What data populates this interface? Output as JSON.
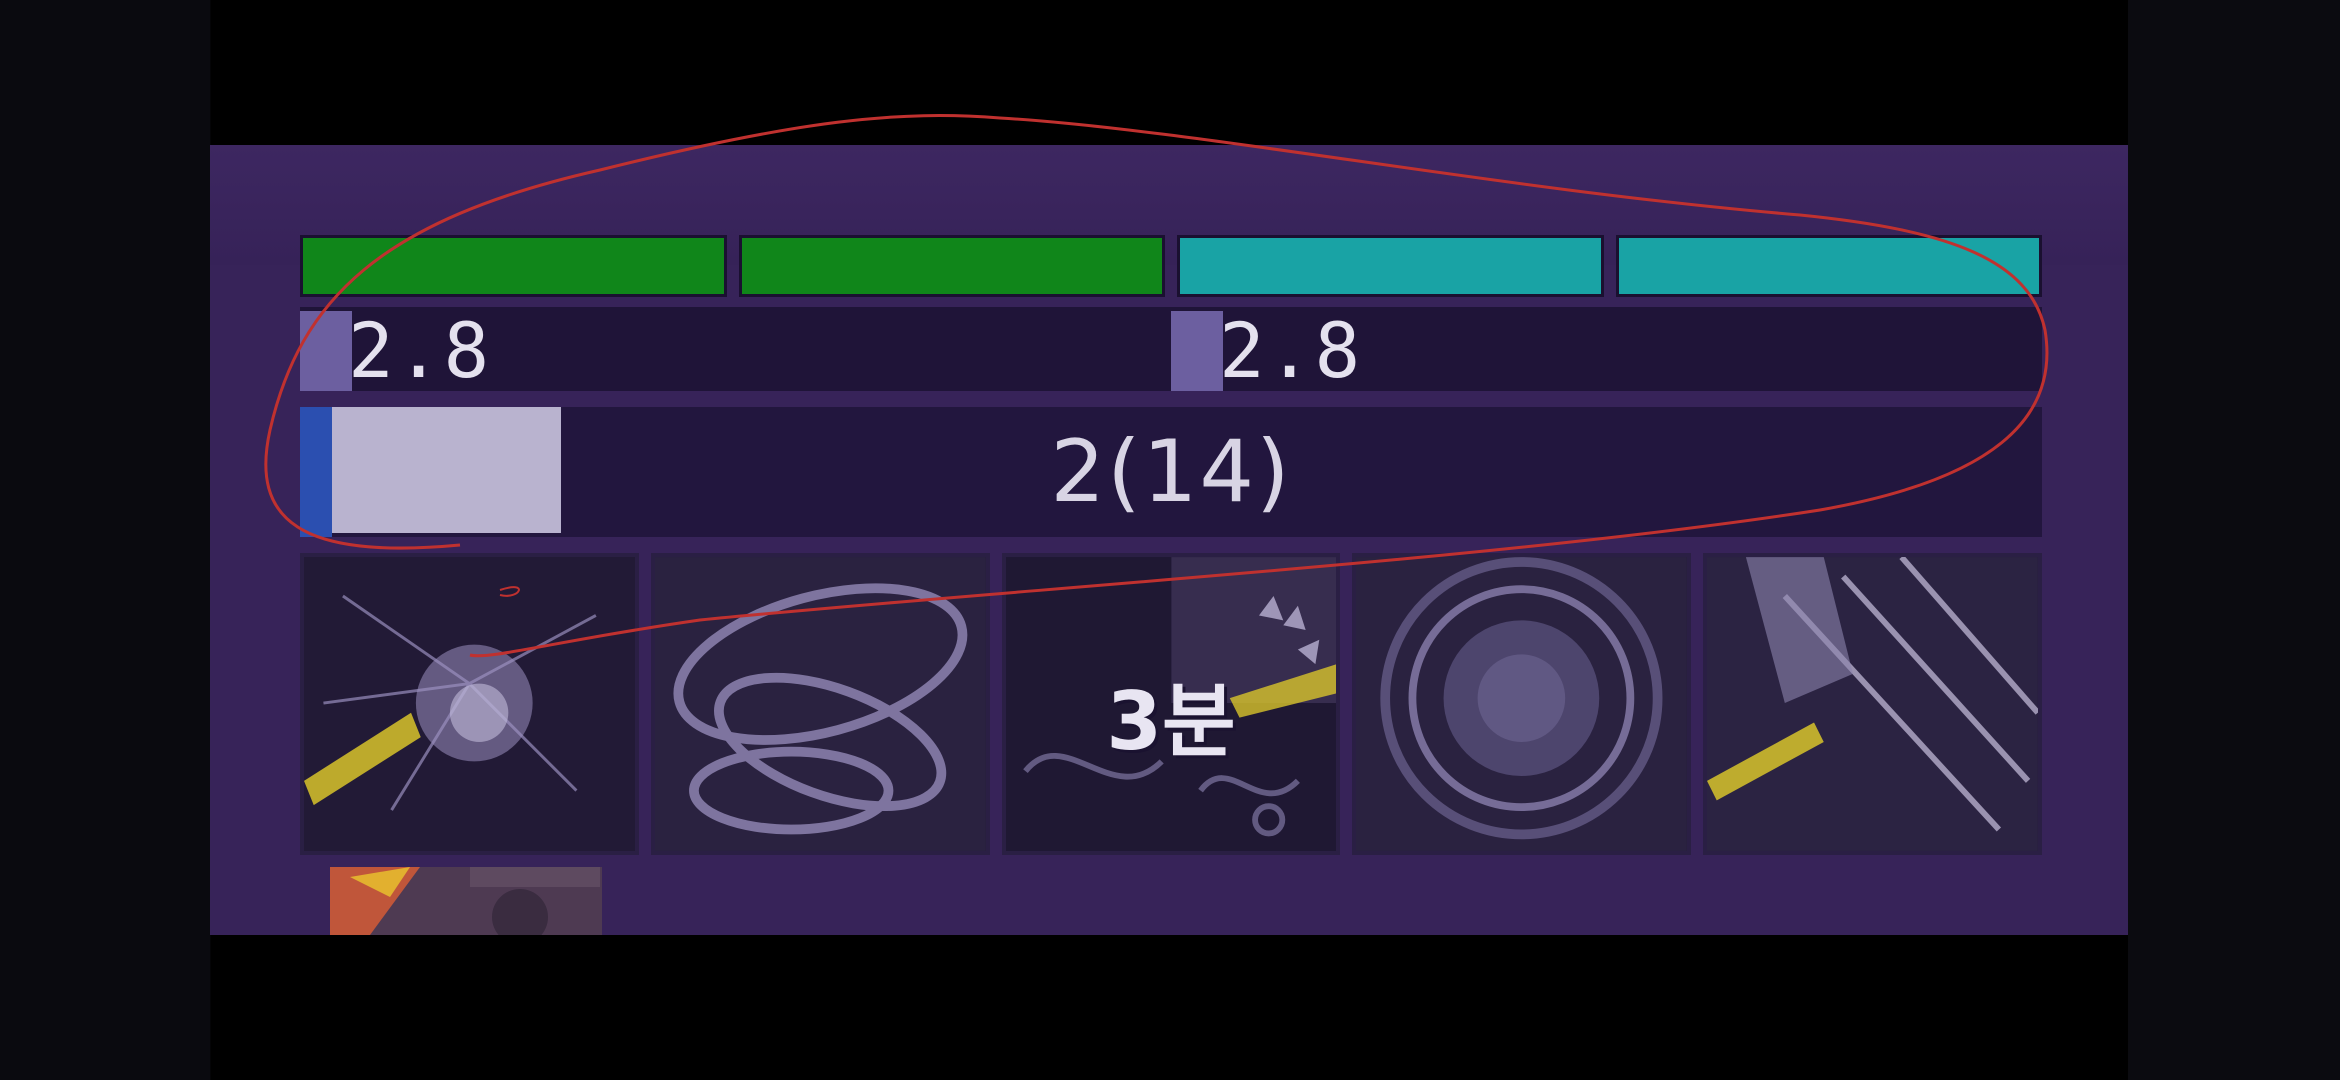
{
  "gauges": [
    {
      "color": "#10861a"
    },
    {
      "color": "#10861a"
    },
    {
      "color": "#19a3a5"
    },
    {
      "color": "#19a3a5"
    }
  ],
  "cooldowns": [
    {
      "value": "2.8",
      "fill_fraction": 0.06
    },
    {
      "value": "2.8",
      "fill_fraction": 0.06
    }
  ],
  "stack": {
    "text": "2(14)",
    "fill_fraction": 0.14
  },
  "skills": [
    {
      "icon": "spark-burst-icon",
      "label": ""
    },
    {
      "icon": "swirl-rings-icon",
      "label": ""
    },
    {
      "icon": "beast-maw-icon",
      "label": "3분"
    },
    {
      "icon": "shockwave-ring-icon",
      "label": ""
    },
    {
      "icon": "slash-streak-icon",
      "label": ""
    }
  ],
  "mini_buff": {
    "icon": "buff-icon"
  },
  "annotation": {
    "color": "#c0312f"
  }
}
